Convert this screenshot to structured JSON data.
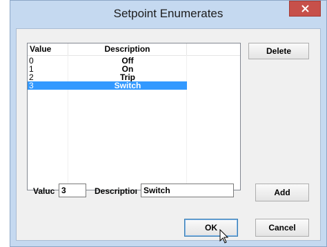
{
  "window": {
    "title": "Setpoint Enumerates"
  },
  "list": {
    "columns": [
      "Value",
      "Description"
    ],
    "rows": [
      {
        "value": "0",
        "description": "Off",
        "selected": false
      },
      {
        "value": "1",
        "description": "On",
        "selected": false
      },
      {
        "value": "2",
        "description": "Trip",
        "selected": false
      },
      {
        "value": "3",
        "description": "Switch",
        "selected": true
      }
    ]
  },
  "buttons": {
    "delete": "Delete",
    "add": "Add",
    "ok": "OK",
    "cancel": "Cancel"
  },
  "fields": {
    "value_label": "Valuϲ",
    "value": "3",
    "description_label": "Descriptioı",
    "description": "Switch"
  },
  "colors": {
    "selection": "#3399ff",
    "close": "#c7504a",
    "frame": "#c5d9f0"
  }
}
